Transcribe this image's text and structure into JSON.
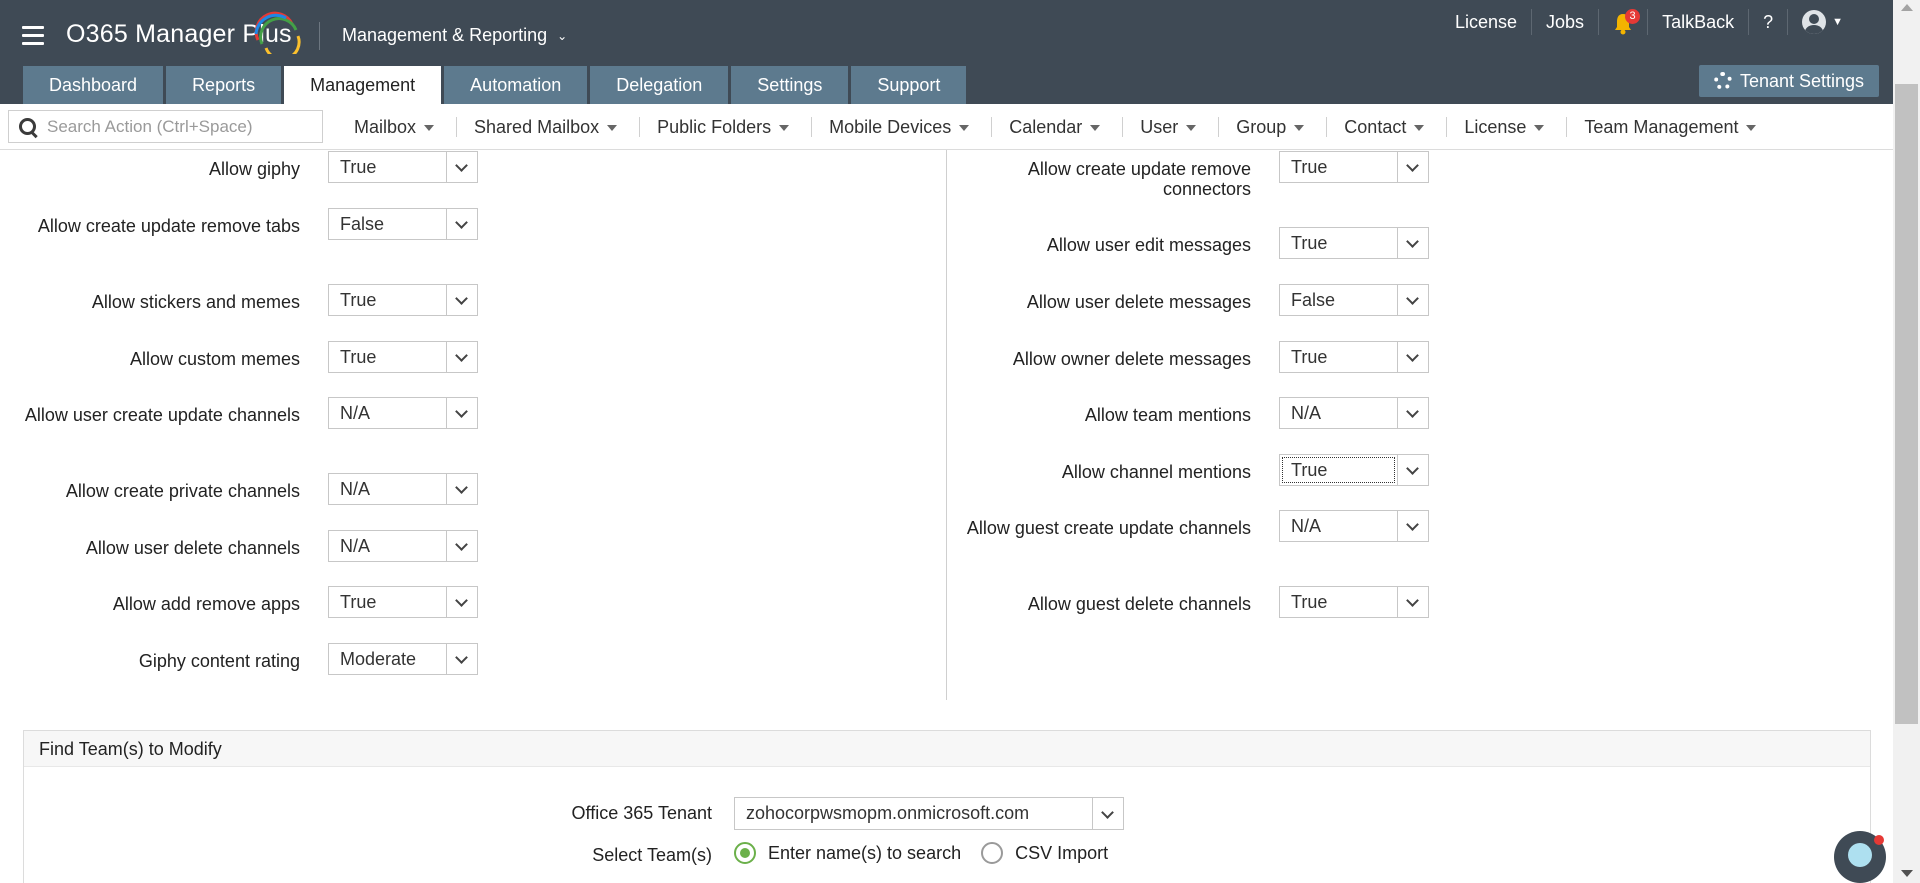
{
  "header": {
    "app_title": "O365 Manager Plus",
    "module": "Management & Reporting",
    "links": {
      "license": "License",
      "jobs": "Jobs",
      "talkback": "TalkBack",
      "help": "?"
    },
    "notification_count": "3",
    "tabs": [
      "Dashboard",
      "Reports",
      "Management",
      "Automation",
      "Delegation",
      "Settings",
      "Support"
    ],
    "active_tab": "Management",
    "tenant_settings": "Tenant Settings"
  },
  "subnav": {
    "search_placeholder": "Search Action (Ctrl+Space)",
    "menus": [
      "Mailbox",
      "Shared Mailbox",
      "Public Folders",
      "Mobile Devices",
      "Calendar",
      "User",
      "Group",
      "Contact",
      "License",
      "Team Management"
    ]
  },
  "settings_left": [
    {
      "label": "Allow giphy",
      "value": "True"
    },
    {
      "label": "Allow create update remove tabs",
      "value": "False"
    },
    {
      "label": "Allow stickers and memes",
      "value": "True"
    },
    {
      "label": "Allow custom memes",
      "value": "True"
    },
    {
      "label": "Allow user create update channels",
      "value": "N/A"
    },
    {
      "label": "Allow create private channels",
      "value": "N/A"
    },
    {
      "label": "Allow user delete channels",
      "value": "N/A"
    },
    {
      "label": "Allow add remove apps",
      "value": "True"
    },
    {
      "label": "Giphy content rating",
      "value": "Moderate"
    }
  ],
  "settings_right": [
    {
      "label": "Allow create update remove connectors",
      "value": "True"
    },
    {
      "label": "Allow user edit messages",
      "value": "True"
    },
    {
      "label": "Allow user delete messages",
      "value": "False"
    },
    {
      "label": "Allow owner delete messages",
      "value": "True"
    },
    {
      "label": "Allow team mentions",
      "value": "N/A"
    },
    {
      "label": "Allow channel mentions",
      "value": "True"
    },
    {
      "label": "Allow guest create update channels",
      "value": "N/A"
    },
    {
      "label": "Allow guest delete channels",
      "value": "True"
    }
  ],
  "find_teams": {
    "title": "Find Team(s) to Modify",
    "tenant_label": "Office 365 Tenant",
    "tenant_value": "zohocorpwsmopm.onmicrosoft.com",
    "select_label": "Select Team(s)",
    "option_search": "Enter name(s) to search",
    "option_csv": "CSV Import"
  },
  "colors": {
    "header_bg": "#3f4a55",
    "tab_bg": "#5d7a8e",
    "accent_green": "#6bb04a",
    "badge_red": "#e53935"
  }
}
